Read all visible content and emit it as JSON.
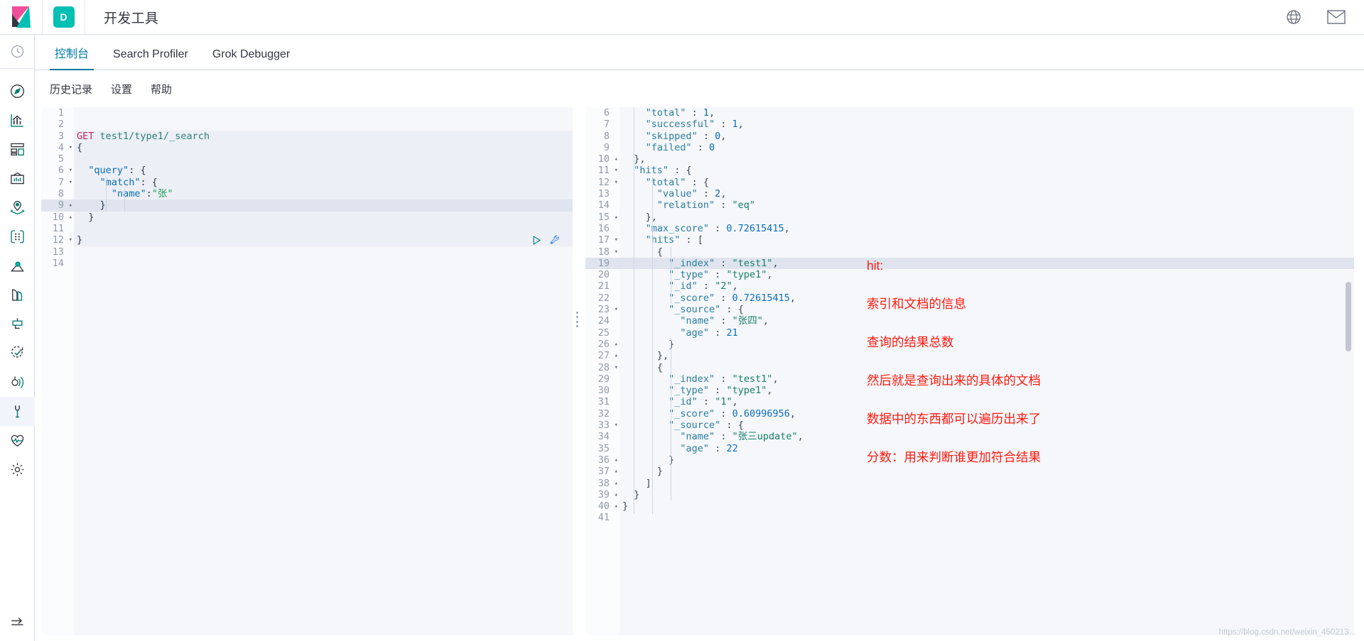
{
  "header": {
    "logo_name": "kibana-logo",
    "space_initial": "D",
    "title": "开发工具",
    "icons": [
      {
        "name": "help-globe-icon",
        "glyph": "?"
      },
      {
        "name": "mail-icon",
        "glyph": "✉"
      }
    ]
  },
  "rail": {
    "items": [
      {
        "name": "recently-viewed",
        "icon": "clock-icon"
      },
      {
        "name": "discover",
        "icon": "compass-icon"
      },
      {
        "name": "visualize",
        "icon": "bar-chart-icon"
      },
      {
        "name": "dashboard",
        "icon": "dashboard-icon"
      },
      {
        "name": "canvas",
        "icon": "canvas-icon"
      },
      {
        "name": "maps",
        "icon": "map-pin-layers-icon"
      },
      {
        "name": "machine-learning",
        "icon": "ml-dots-icon"
      },
      {
        "name": "infrastructure",
        "icon": "infra-icon"
      },
      {
        "name": "logs",
        "icon": "logs-icon"
      },
      {
        "name": "apm",
        "icon": "apm-icon"
      },
      {
        "name": "uptime",
        "icon": "uptime-check-icon"
      },
      {
        "name": "siem",
        "icon": "siem-signal-icon"
      },
      {
        "name": "dev-tools",
        "icon": "wrench-icon",
        "selected": true
      },
      {
        "name": "monitoring",
        "icon": "heart-icon"
      },
      {
        "name": "management",
        "icon": "gear-icon"
      },
      {
        "name": "collapse-nav",
        "icon": "arrow-collapse-icon"
      }
    ]
  },
  "tabs": [
    {
      "label": "控制台",
      "active": true
    },
    {
      "label": "Search Profiler",
      "active": false
    },
    {
      "label": "Grok Debugger",
      "active": false
    }
  ],
  "submenu": [
    {
      "label": "历史记录"
    },
    {
      "label": "设置"
    },
    {
      "label": "帮助"
    }
  ],
  "request_actions": [
    {
      "name": "send-request-button",
      "icon": "play-icon"
    },
    {
      "name": "open-documentation-button",
      "icon": "wrench-icon"
    }
  ],
  "request_editor": {
    "total_lines": 14,
    "active_line": 9,
    "lines": [
      {
        "n": 1,
        "fold": "",
        "text": ""
      },
      {
        "n": 2,
        "fold": "",
        "text": ""
      },
      {
        "n": 3,
        "fold": "",
        "text": "GET test1/type1/_search",
        "kind": "request-line"
      },
      {
        "n": 4,
        "fold": "▾",
        "text": "{"
      },
      {
        "n": 5,
        "fold": "",
        "text": ""
      },
      {
        "n": 6,
        "fold": "▾",
        "text": "  \"query\": {"
      },
      {
        "n": 7,
        "fold": "▾",
        "text": "    \"match\": {"
      },
      {
        "n": 8,
        "fold": "",
        "text": "      \"name\":\"张\""
      },
      {
        "n": 9,
        "fold": "▴",
        "text": "    }"
      },
      {
        "n": 10,
        "fold": "▴",
        "text": "  }"
      },
      {
        "n": 11,
        "fold": "",
        "text": ""
      },
      {
        "n": 12,
        "fold": "▾",
        "text": "}"
      },
      {
        "n": 13,
        "fold": "",
        "text": ""
      },
      {
        "n": 14,
        "fold": "",
        "text": ""
      }
    ],
    "method": "GET",
    "path": "test1/type1/_search"
  },
  "response_editor": {
    "first_visible_line": 6,
    "last_visible_line": 41,
    "active_line": 19,
    "lines": [
      {
        "n": 6,
        "fold": "",
        "text": "    \"total\" : 1,"
      },
      {
        "n": 7,
        "fold": "",
        "text": "    \"successful\" : 1,"
      },
      {
        "n": 8,
        "fold": "",
        "text": "    \"skipped\" : 0,"
      },
      {
        "n": 9,
        "fold": "",
        "text": "    \"failed\" : 0"
      },
      {
        "n": 10,
        "fold": "▴",
        "text": "  },"
      },
      {
        "n": 11,
        "fold": "▾",
        "text": "  \"hits\" : {"
      },
      {
        "n": 12,
        "fold": "▾",
        "text": "    \"total\" : {"
      },
      {
        "n": 13,
        "fold": "",
        "text": "      \"value\" : 2,"
      },
      {
        "n": 14,
        "fold": "",
        "text": "      \"relation\" : \"eq\""
      },
      {
        "n": 15,
        "fold": "▴",
        "text": "    },"
      },
      {
        "n": 16,
        "fold": "",
        "text": "    \"max_score\" : 0.72615415,"
      },
      {
        "n": 17,
        "fold": "▾",
        "text": "    \"hits\" : ["
      },
      {
        "n": 18,
        "fold": "▾",
        "text": "      {"
      },
      {
        "n": 19,
        "fold": "",
        "text": "        \"_index\" : \"test1\","
      },
      {
        "n": 20,
        "fold": "",
        "text": "        \"_type\" : \"type1\","
      },
      {
        "n": 21,
        "fold": "",
        "text": "        \"_id\" : \"2\","
      },
      {
        "n": 22,
        "fold": "",
        "text": "        \"_score\" : 0.72615415,"
      },
      {
        "n": 23,
        "fold": "▾",
        "text": "        \"_source\" : {"
      },
      {
        "n": 24,
        "fold": "",
        "text": "          \"name\" : \"张四\","
      },
      {
        "n": 25,
        "fold": "",
        "text": "          \"age\" : 21"
      },
      {
        "n": 26,
        "fold": "▴",
        "text": "        }"
      },
      {
        "n": 27,
        "fold": "▴",
        "text": "      },"
      },
      {
        "n": 28,
        "fold": "▾",
        "text": "      {"
      },
      {
        "n": 29,
        "fold": "",
        "text": "        \"_index\" : \"test1\","
      },
      {
        "n": 30,
        "fold": "",
        "text": "        \"_type\" : \"type1\","
      },
      {
        "n": 31,
        "fold": "",
        "text": "        \"_id\" : \"1\","
      },
      {
        "n": 32,
        "fold": "",
        "text": "        \"_score\" : 0.60996956,"
      },
      {
        "n": 33,
        "fold": "▾",
        "text": "        \"_source\" : {"
      },
      {
        "n": 34,
        "fold": "",
        "text": "          \"name\" : \"张三update\","
      },
      {
        "n": 35,
        "fold": "",
        "text": "          \"age\" : 22"
      },
      {
        "n": 36,
        "fold": "▴",
        "text": "        }"
      },
      {
        "n": 37,
        "fold": "▴",
        "text": "      }"
      },
      {
        "n": 38,
        "fold": "▴",
        "text": "    ]"
      },
      {
        "n": 39,
        "fold": "▴",
        "text": "  }"
      },
      {
        "n": 40,
        "fold": "▴",
        "text": "}"
      },
      {
        "n": 41,
        "fold": "",
        "text": ""
      }
    ],
    "values": {
      "shards_total": 1,
      "shards_successful": 1,
      "shards_skipped": 0,
      "shards_failed": 0,
      "hits_total_value": 2,
      "hits_total_relation": "eq",
      "max_score": 0.72615415,
      "hit1": {
        "_index": "test1",
        "_type": "type1",
        "_id": "2",
        "_score": 0.72615415,
        "name": "张四",
        "age": 21
      },
      "hit2": {
        "_index": "test1",
        "_type": "type1",
        "_id": "1",
        "_score": 0.60996956,
        "name": "张三update",
        "age": 22
      }
    }
  },
  "annotation": {
    "color": "#ff1a10",
    "lines": [
      "hit:",
      "索引和文档的信息",
      "查询的结果总数",
      "然后就是查询出来的具体的文档",
      "数据中的东西都可以遍历出来了",
      "分数：用来判断谁更加符合结果"
    ]
  },
  "watermark": "https://blog.csdn.net/weixin_450213…"
}
